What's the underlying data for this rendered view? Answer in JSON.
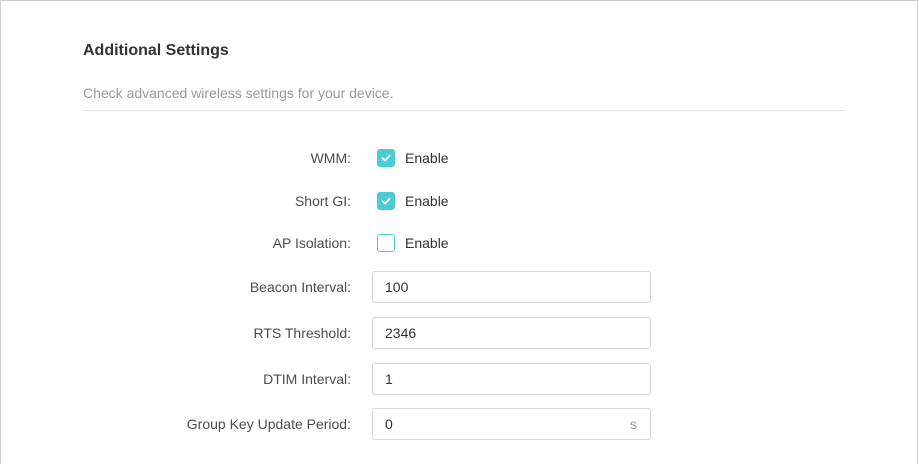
{
  "section": {
    "title": "Additional Settings",
    "description": "Check advanced wireless settings for your device."
  },
  "checkboxes": [
    {
      "label": "WMM:",
      "text": "Enable",
      "checked": true
    },
    {
      "label": "Short GI:",
      "text": "Enable",
      "checked": true
    },
    {
      "label": "AP Isolation:",
      "text": "Enable",
      "checked": false
    }
  ],
  "fields": [
    {
      "label": "Beacon Interval:",
      "value": "100"
    },
    {
      "label": "RTS Threshold:",
      "value": "2346"
    },
    {
      "label": "DTIM Interval:",
      "value": "1"
    },
    {
      "label": "Group Key Update Period:",
      "value": "0",
      "unit": "s"
    }
  ],
  "colors": {
    "accent": "#4acbd6",
    "label": "#4d4d4d",
    "muted": "#999999"
  }
}
